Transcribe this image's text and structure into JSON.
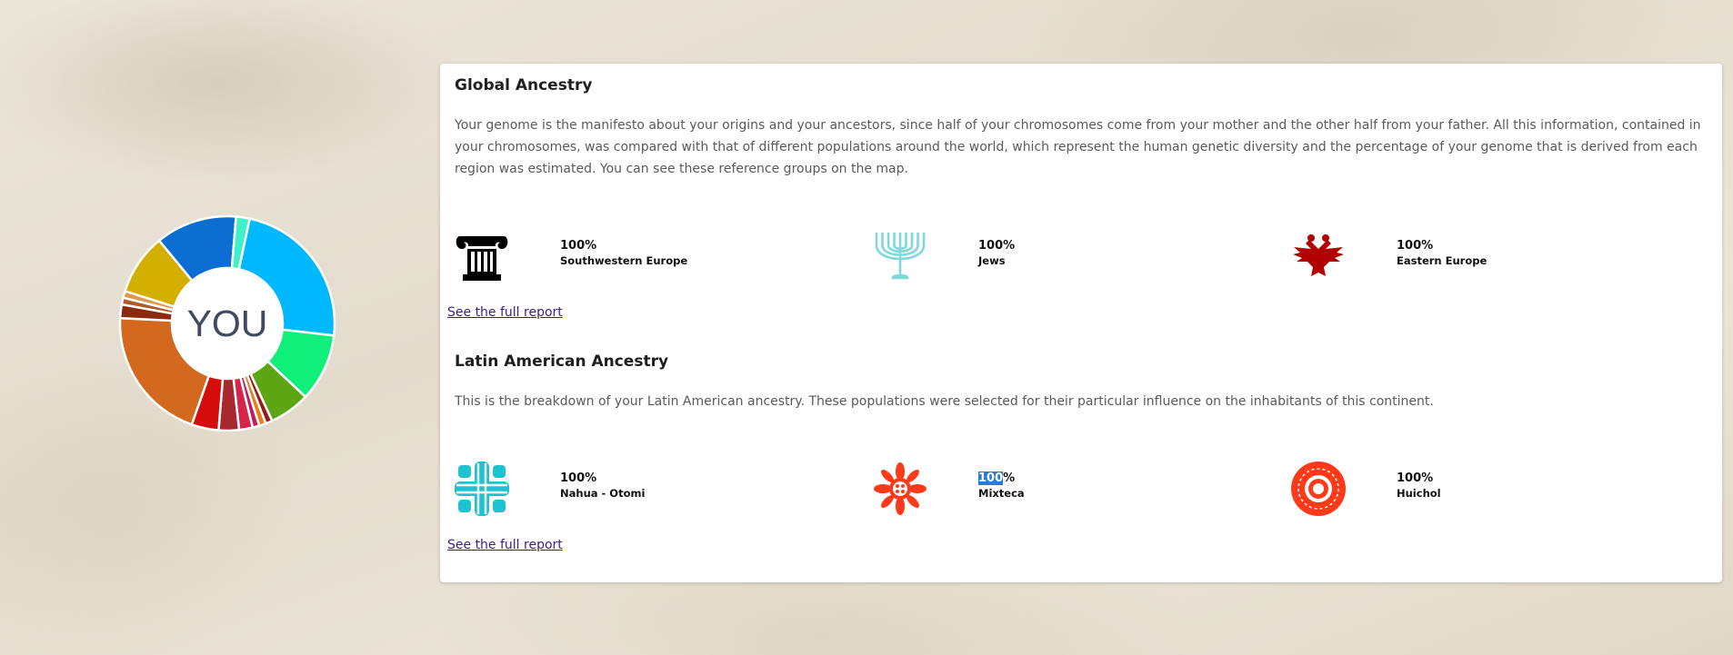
{
  "donut": {
    "center_label": "YOU",
    "segments": [
      {
        "value": 23,
        "color": "#00b8ff"
      },
      {
        "value": 10,
        "color": "#0fef7a"
      },
      {
        "value": 6,
        "color": "#5ea514"
      },
      {
        "value": 1,
        "color": "#9a1a1a"
      },
      {
        "value": 1,
        "color": "#ee7a1a"
      },
      {
        "value": 1,
        "color": "#c21d5a"
      },
      {
        "value": 2,
        "color": "#d6244a"
      },
      {
        "value": 3,
        "color": "#a8282e"
      },
      {
        "value": 4,
        "color": "#d40c0c"
      },
      {
        "value": 20,
        "color": "#d2691e"
      },
      {
        "value": 2,
        "color": "#8b2a0e"
      },
      {
        "value": 1,
        "color": "#b05a28"
      },
      {
        "value": 1,
        "color": "#e09a50"
      },
      {
        "value": 9,
        "color": "#d3b000"
      },
      {
        "value": 12,
        "color": "#0d6ed2"
      },
      {
        "value": 2,
        "color": "#3ff0c8"
      }
    ]
  },
  "global": {
    "title": "Global Ancestry",
    "description": "Your genome is the manifesto about your origins and your ancestors, since half of your chromosomes come from your mother and the other half from your father. All this information, contained in your chromosomes, was compared with that of different populations around the world, which represent the human genetic diversity and the percentage of your genome that is derived from each region was estimated. You can see these reference groups on the map.",
    "populations": [
      {
        "percent": "100%",
        "name": "Southwestern Europe",
        "icon": "ionic-column-icon",
        "color": "#000000"
      },
      {
        "percent": "100%",
        "name": "Jews",
        "icon": "menorah-icon",
        "color": "#7fd8dc"
      },
      {
        "percent": "100%",
        "name": "Eastern Europe",
        "icon": "double-headed-eagle-icon",
        "color": "#b00000"
      }
    ],
    "link": "See the full report"
  },
  "latin": {
    "title": "Latin American Ancestry",
    "description": "This is the breakdown of your Latin American ancestry. These populations were selected for their particular influence on the inhabitants of this continent.",
    "populations": [
      {
        "percent": "100%",
        "name": "Nahua - Otomi",
        "icon": "cross-icon",
        "color": "#1ec2d0"
      },
      {
        "percent_hl": "100",
        "percent_rest": "%",
        "name": "Mixteca",
        "icon": "flower-icon",
        "color": "#ff3a1a"
      },
      {
        "percent": "100%",
        "name": "Huichol",
        "icon": "target-icon",
        "color": "#ff3a1a"
      }
    ],
    "link": "See the full report"
  }
}
